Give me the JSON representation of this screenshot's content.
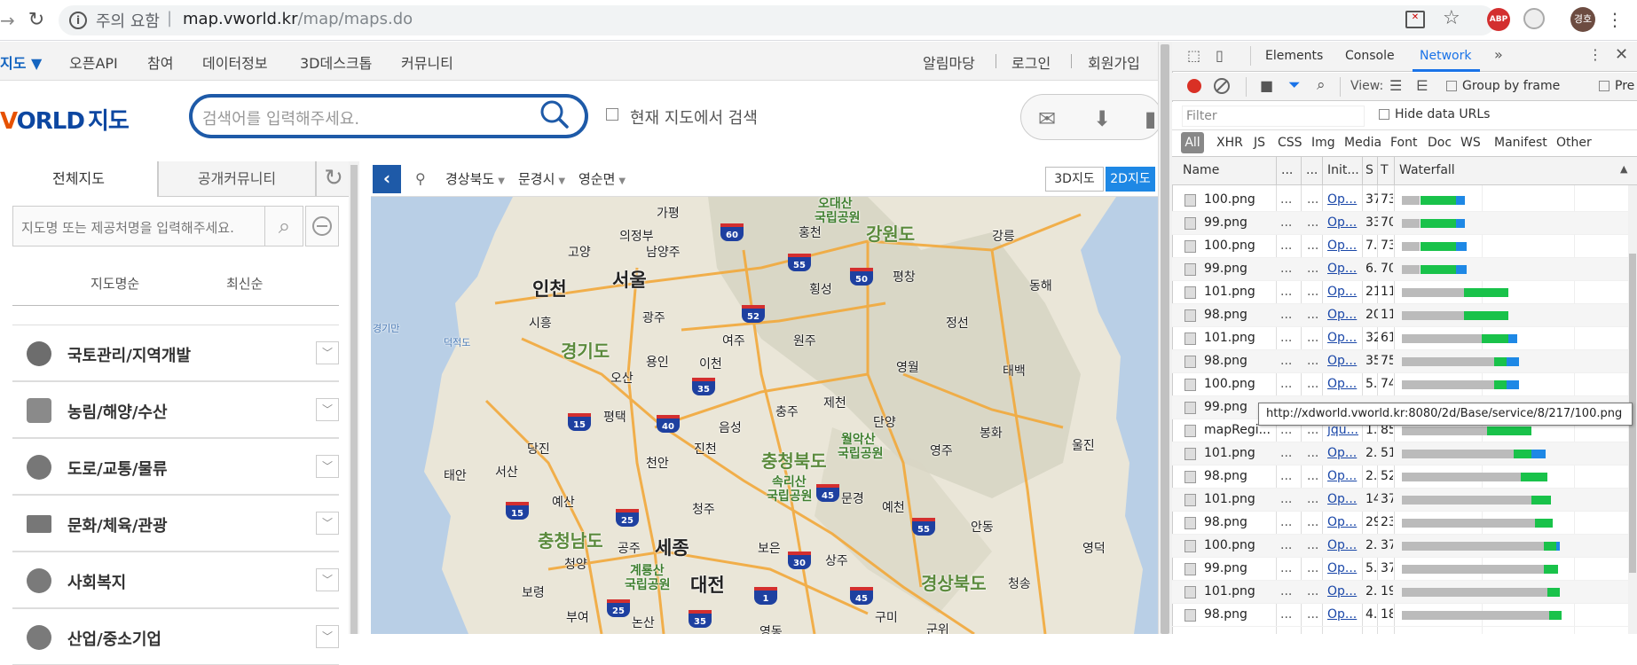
{
  "browser": {
    "insecure_label": "주의 요함",
    "separator": "|",
    "url_host": "map.vworld.kr",
    "url_path": "/map/maps.do",
    "abp_label": "ABP",
    "profile_label": "경호"
  },
  "site_nav": {
    "items": [
      "지도 ▼",
      "오픈API",
      "참여",
      "데이터정보",
      "3D데스크톱",
      "커뮤니티"
    ],
    "right_items": [
      "알림마당",
      "로그인",
      "회원가입"
    ]
  },
  "header": {
    "logo_v": "V",
    "logo_rest": "ORLD",
    "logo_ko": "지도",
    "search_placeholder": "검색어를 입력해주세요.",
    "current_map_search": "현재 지도에서 검색"
  },
  "left_panel": {
    "tab_all": "전체지도",
    "tab_community": "공개커뮤니티",
    "map_search_placeholder": "지도명 또는 제공처명을 입력해주세요.",
    "sort_name": "지도명순",
    "sort_latest": "최신순",
    "categories": [
      "국토관리/지역개발",
      "농림/해양/수산",
      "도로/교통/물류",
      "문화/체육/관광",
      "사회복지",
      "산업/중소기업"
    ]
  },
  "map_toolbar": {
    "locations": [
      "경상북도",
      "문경시",
      "영순면"
    ],
    "btn_3d": "3D지도",
    "btn_2d": "2D지도"
  },
  "map": {
    "labels": [
      "가평",
      "오대산",
      "국립공원",
      "홍천",
      "강원도",
      "강릉",
      "의정부",
      "고양",
      "남양주",
      "인천",
      "서울",
      "횡성",
      "평창",
      "동해",
      "시흥",
      "광주",
      "여주",
      "원주",
      "정선",
      "경기도",
      "용인",
      "이천",
      "영월",
      "태백",
      "오산",
      "충주",
      "제천",
      "평택",
      "음성",
      "단양",
      "봉화",
      "울진",
      "당진",
      "천안",
      "진천",
      "충청북도",
      "월악산",
      "영주",
      "태안",
      "서산",
      "예산",
      "청주",
      "속리산",
      "문경",
      "예천",
      "충청남도",
      "공주",
      "세종",
      "보은",
      "상주",
      "안동",
      "영덕",
      "청양",
      "계룡산",
      "대전",
      "경상북도",
      "청송",
      "보령",
      "부여",
      "논산",
      "영동",
      "구미",
      "군위"
    ],
    "sea_labels": [
      "경기만",
      "덕적도"
    ],
    "shields": [
      "60",
      "55",
      "50",
      "52",
      "35",
      "15",
      "40",
      "45",
      "25",
      "55",
      "30",
      "1",
      "45",
      "25",
      "35",
      "15"
    ]
  },
  "devtools": {
    "tabs": [
      "Elements",
      "Console",
      "Network"
    ],
    "view_label": "View:",
    "group_by_frame": "Group by frame",
    "preserve": "Pre",
    "filter_placeholder": "Filter",
    "hide_data_urls": "Hide data URLs",
    "filter_types": [
      "All",
      "XHR",
      "JS",
      "CSS",
      "Img",
      "Media",
      "Font",
      "Doc",
      "WS",
      "Manifest",
      "Other"
    ],
    "columns": [
      "Name",
      "...",
      "...",
      "Init...",
      "S",
      "T",
      "Waterfall"
    ],
    "rows": [
      {
        "name": "100.png",
        "d1": "...",
        "d2": "...",
        "init": "Op...",
        "size": "37",
        "time": "73"
      },
      {
        "name": "99.png",
        "d1": "...",
        "d2": "...",
        "init": "Op...",
        "size": "33",
        "time": "70"
      },
      {
        "name": "100.png",
        "d1": "...",
        "d2": "...",
        "init": "Op...",
        "size": "7.",
        "time": "73"
      },
      {
        "name": "99.png",
        "d1": "...",
        "d2": "...",
        "init": "Op...",
        "size": "6.",
        "time": "70"
      },
      {
        "name": "101.png",
        "d1": "...",
        "d2": "...",
        "init": "Op...",
        "size": "21",
        "time": "11"
      },
      {
        "name": "98.png",
        "d1": "...",
        "d2": "...",
        "init": "Op...",
        "size": "20",
        "time": "11"
      },
      {
        "name": "101.png",
        "d1": "...",
        "d2": "...",
        "init": "Op...",
        "size": "32",
        "time": "61"
      },
      {
        "name": "98.png",
        "d1": "...",
        "d2": "...",
        "init": "Op...",
        "size": "35",
        "time": "75"
      },
      {
        "name": "100.png",
        "d1": "...",
        "d2": "...",
        "init": "Op...",
        "size": "5.",
        "time": "74"
      },
      {
        "name": "99.png",
        "d1": "...",
        "d2": "...",
        "init": "",
        "size": "",
        "time": ""
      },
      {
        "name": "mapRegi...",
        "d1": "...",
        "d2": "...",
        "init": "jqu...",
        "size": "1.",
        "time": "85"
      },
      {
        "name": "101.png",
        "d1": "...",
        "d2": "...",
        "init": "Op...",
        "size": "2.",
        "time": "51"
      },
      {
        "name": "98.png",
        "d1": "...",
        "d2": "...",
        "init": "Op...",
        "size": "2.",
        "time": "52"
      },
      {
        "name": "101.png",
        "d1": "...",
        "d2": "...",
        "init": "Op...",
        "size": "14",
        "time": "37"
      },
      {
        "name": "98.png",
        "d1": "...",
        "d2": "...",
        "init": "Op...",
        "size": "29",
        "time": "23"
      },
      {
        "name": "100.png",
        "d1": "...",
        "d2": "...",
        "init": "Op...",
        "size": "2.",
        "time": "37"
      },
      {
        "name": "99.png",
        "d1": "...",
        "d2": "...",
        "init": "Op...",
        "size": "5.",
        "time": "37"
      },
      {
        "name": "101.png",
        "d1": "...",
        "d2": "...",
        "init": "Op...",
        "size": "2.",
        "time": "19"
      },
      {
        "name": "98.png",
        "d1": "...",
        "d2": "...",
        "init": "Op...",
        "size": "4.",
        "time": "18"
      }
    ],
    "tooltip": "http://xdworld.vworld.kr:8080/2d/Base/service/8/217/100.png"
  }
}
